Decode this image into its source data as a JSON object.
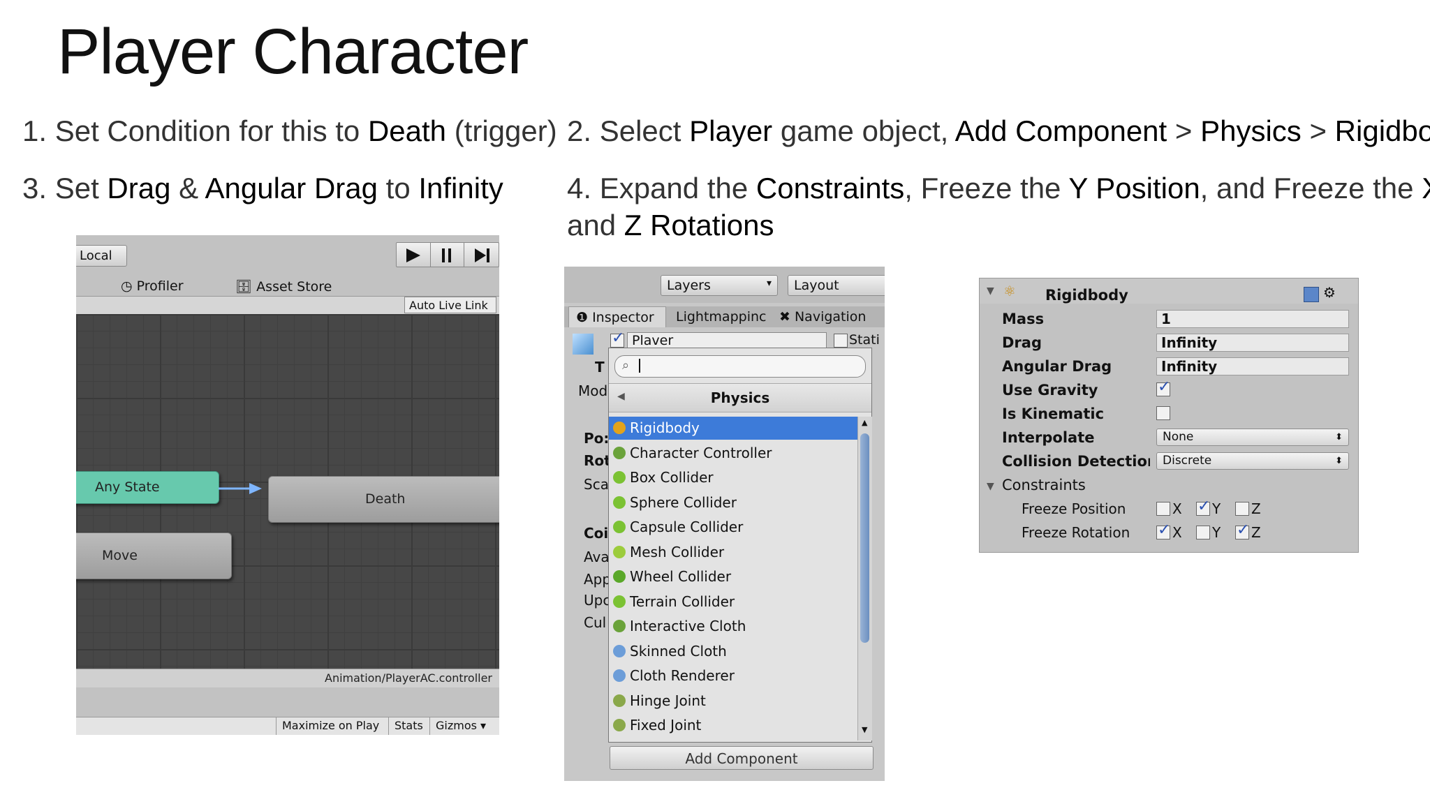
{
  "slide": {
    "title": "Player Character",
    "steps": [
      {
        "num": "1.",
        "parts": [
          [
            "Set Condition for this to ",
            0
          ],
          [
            "Death",
            1
          ],
          [
            " (trigger)",
            0
          ]
        ]
      },
      {
        "num": "2.",
        "parts": [
          [
            "Select ",
            0
          ],
          [
            "Player",
            1
          ],
          [
            " game object, ",
            0
          ],
          [
            "Add Component",
            1
          ],
          [
            " > ",
            0
          ],
          [
            "Physics",
            1
          ],
          [
            " > ",
            0
          ],
          [
            "Rigidbody",
            1
          ]
        ]
      },
      {
        "num": "3.",
        "parts": [
          [
            "Set ",
            0
          ],
          [
            "Drag",
            1
          ],
          [
            " & ",
            0
          ],
          [
            "Angular Drag",
            1
          ],
          [
            " to ",
            0
          ],
          [
            "Infinity",
            1
          ]
        ]
      },
      {
        "num": "4.",
        "parts": [
          [
            "Expand the ",
            0
          ],
          [
            "Constraints",
            1
          ],
          [
            ", Freeze the ",
            0
          ],
          [
            "Y Position",
            1
          ],
          [
            ", and Freeze the ",
            0
          ],
          [
            "X",
            1
          ]
        ]
      },
      {
        "num": "",
        "parts": [
          [
            "and ",
            0
          ],
          [
            "Z Rotations",
            1
          ]
        ]
      }
    ]
  },
  "animator": {
    "local_label": "Local",
    "profiler_tab": "Profiler",
    "asset_store_tab": "Asset Store",
    "auto_live_link": "Auto Live Link",
    "states": {
      "any_state": "Any State",
      "death": "Death",
      "move": "Move"
    },
    "controller_path": "Animation/PlayerAC.controller",
    "bottom_buttons": {
      "maximize": "Maximize on Play",
      "stats": "Stats",
      "gizmos": "Gizmos"
    }
  },
  "inspector": {
    "layers_dropdown": "Layers",
    "layout_dropdown": "Layout",
    "tabs": {
      "inspector": "Inspector",
      "lightmapping": "Lightmappinc",
      "navigation": "Navigation"
    },
    "object_name": "Plaver",
    "static_label": "Stati",
    "side_labels": [
      "T",
      "Mod",
      "Po:",
      "Rot",
      "Sca",
      "Coi",
      "Ava",
      "App",
      "Upc",
      "Cul"
    ],
    "search_placeholder": "",
    "popup_header": "Physics",
    "components": [
      {
        "label": "Rigidbody",
        "color": "#e2a31c",
        "selected": true
      },
      {
        "label": "Character Controller",
        "color": "#6aa23a"
      },
      {
        "label": "Box Collider",
        "color": "#7bc233"
      },
      {
        "label": "Sphere Collider",
        "color": "#7bc233"
      },
      {
        "label": "Capsule Collider",
        "color": "#7bc233"
      },
      {
        "label": "Mesh Collider",
        "color": "#9ccc3c"
      },
      {
        "label": "Wheel Collider",
        "color": "#5aa829"
      },
      {
        "label": "Terrain Collider",
        "color": "#7bc233"
      },
      {
        "label": "Interactive Cloth",
        "color": "#6aa23a"
      },
      {
        "label": "Skinned Cloth",
        "color": "#6c9dd8"
      },
      {
        "label": "Cloth Renderer",
        "color": "#6c9dd8"
      },
      {
        "label": "Hinge Joint",
        "color": "#8aa84a"
      },
      {
        "label": "Fixed Joint",
        "color": "#8aa84a"
      }
    ],
    "add_component_button": "Add Component"
  },
  "rigidbody": {
    "header": "Rigidbody",
    "fields": {
      "mass_label": "Mass",
      "mass_value": "1",
      "drag_label": "Drag",
      "drag_value": "Infinity",
      "angular_drag_label": "Angular Drag",
      "angular_drag_value": "Infinity",
      "use_gravity_label": "Use Gravity",
      "use_gravity_checked": true,
      "is_kinematic_label": "Is Kinematic",
      "is_kinematic_checked": false,
      "interpolate_label": "Interpolate",
      "interpolate_value": "None",
      "collision_label": "Collision Detection",
      "collision_value": "Discrete"
    },
    "constraints_label": "Constraints",
    "freeze_position": {
      "label": "Freeze Position",
      "x": false,
      "y": true,
      "z": false
    },
    "freeze_rotation": {
      "label": "Freeze Rotation",
      "x": true,
      "y": false,
      "z": true
    },
    "axes": {
      "x": "X",
      "y": "Y",
      "z": "Z"
    }
  }
}
